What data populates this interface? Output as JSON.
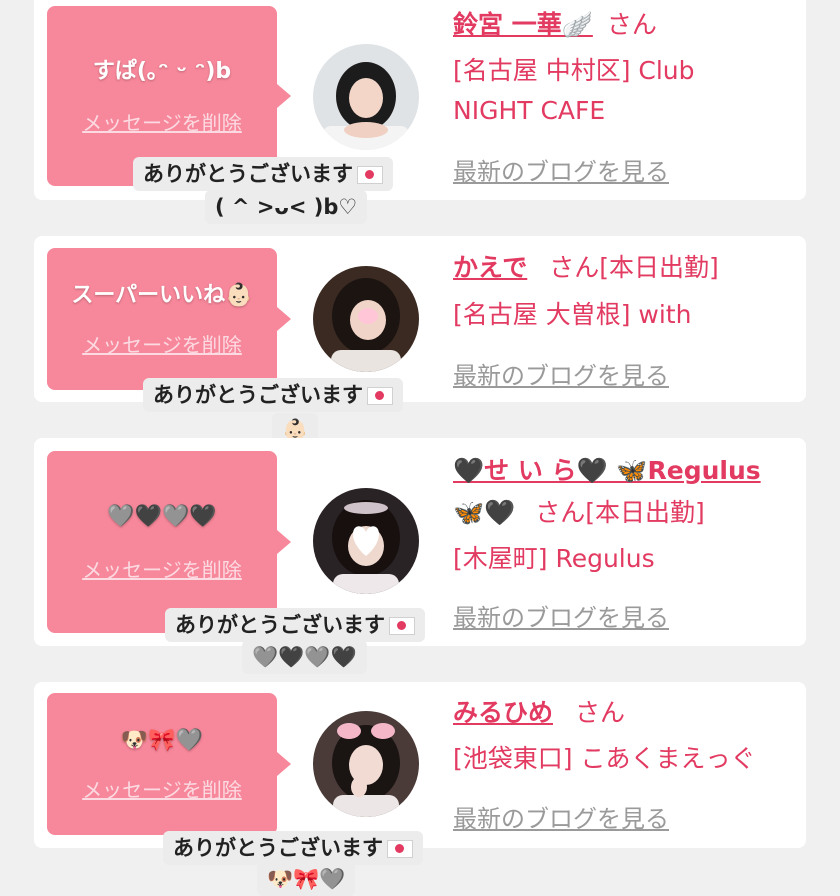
{
  "entries": [
    {
      "message": "すぱ(｡ᵔ ᵕ ᵔ)b",
      "delete_label": "メッセージを削除",
      "name": "鈴宮 一華🪽",
      "san": "さん",
      "name_line2": "",
      "shop_line1": "[名古屋 中村区] Club",
      "shop_line2": "NIGHT CAFE",
      "blog_label": "最新のブログを見る",
      "thanks_label": "ありがとうございます",
      "thanks_sub": "( ^ >ᴗ< )b♡"
    },
    {
      "message": "スーパーいいね👶🏻",
      "delete_label": "メッセージを削除",
      "name": "かえで",
      "san": "さん[本日出勤]",
      "name_line2": "",
      "shop_line1": "[名古屋 大曽根] with",
      "shop_line2": "",
      "blog_label": "最新のブログを見る",
      "thanks_label": "ありがとうございます",
      "thanks_sub": "👶🏻"
    },
    {
      "message": "🩶🖤🩶🖤",
      "delete_label": "メッセージを削除",
      "name": "🖤せ い ら🖤 🦋Regulus",
      "san": "さん[本日出勤]",
      "name_line2": "🦋🖤",
      "shop_line1": "[木屋町] Regulus",
      "shop_line2": "",
      "blog_label": "最新のブログを見る",
      "thanks_label": "ありがとうございます",
      "thanks_sub": "🩶🖤🩶🖤"
    },
    {
      "message": "🐶🎀🩶",
      "delete_label": "メッセージを削除",
      "name": "みるひめ",
      "san": "さん",
      "name_line2": "",
      "shop_line1": "[池袋東口] こあくまえっぐ",
      "shop_line2": "",
      "blog_label": "最新のブログを見る",
      "thanks_label": "ありがとうございます",
      "thanks_sub": "🐶🎀🩶"
    }
  ]
}
